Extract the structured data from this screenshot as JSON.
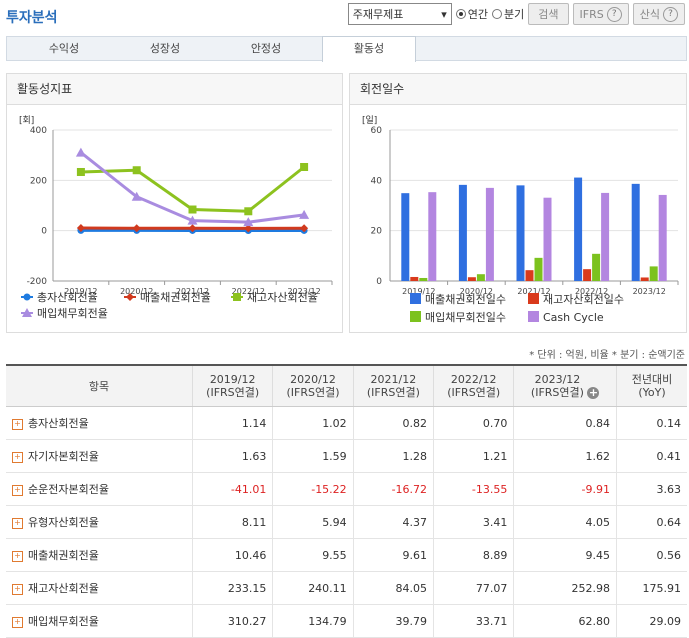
{
  "title": "투자분석",
  "controls": {
    "select_value": "주재무제표",
    "radio_annual": "연간",
    "radio_quarter": "분기",
    "search_label": "검색",
    "ifrs_label": "IFRS",
    "formula_label": "산식"
  },
  "tabs": [
    "수익성",
    "성장성",
    "안정성",
    "활동성"
  ],
  "active_tab": "활동성",
  "panel_left_title": "활동성지표",
  "panel_right_title": "회전일수",
  "unit_note": "* 단위 : 억원, 비율    * 분기 : 순액기준",
  "chart_data": [
    {
      "type": "line",
      "ylabel": "[회]",
      "ylim": [
        -200,
        400
      ],
      "yticks": [
        400,
        200,
        0,
        -200
      ],
      "categories": [
        "2019/12",
        "2020/12",
        "2021/12",
        "2022/12",
        "2023/12"
      ],
      "series": [
        {
          "name": "총자산회전율",
          "color": "#1e7be0",
          "marker": "circle",
          "values": [
            1.14,
            1.02,
            0.82,
            0.7,
            0.84
          ]
        },
        {
          "name": "매출채권회전율",
          "color": "#d13a1e",
          "marker": "diamond",
          "values": [
            10.46,
            9.55,
            9.61,
            8.89,
            9.45
          ]
        },
        {
          "name": "재고자산회전율",
          "color": "#8dc21f",
          "marker": "square",
          "values": [
            233.15,
            240.11,
            84.05,
            77.07,
            252.98
          ]
        },
        {
          "name": "매입채무회전율",
          "color": "#a98ce0",
          "marker": "triangle",
          "values": [
            310.27,
            134.79,
            39.79,
            33.71,
            62.8
          ]
        }
      ]
    },
    {
      "type": "bar",
      "ylabel": "[일]",
      "ylim": [
        0,
        60
      ],
      "yticks": [
        60,
        40,
        20,
        0
      ],
      "categories": [
        "2019/12",
        "2020/12",
        "2021/12",
        "2022/12",
        "2023/12"
      ],
      "series": [
        {
          "name": "매출채권회전일수",
          "color": "#2f6fe0",
          "values": [
            34.9,
            38.2,
            38.0,
            41.1,
            38.6
          ]
        },
        {
          "name": "재고자산회전일수",
          "color": "#d93a1c",
          "values": [
            1.6,
            1.5,
            4.3,
            4.7,
            1.4
          ]
        },
        {
          "name": "매입채무회전일수",
          "color": "#7cc21e",
          "values": [
            1.2,
            2.7,
            9.2,
            10.8,
            5.8
          ]
        },
        {
          "name": "Cash Cycle",
          "color": "#b386e0",
          "values": [
            35.3,
            37.0,
            33.1,
            35.0,
            34.2
          ]
        }
      ]
    }
  ],
  "table": {
    "headers": [
      "항목",
      "2019/12\n(IFRS연결)",
      "2020/12\n(IFRS연결)",
      "2021/12\n(IFRS연결)",
      "2022/12\n(IFRS연결)",
      "2023/12\n(IFRS연결)",
      "전년대비\n(YoY)"
    ],
    "rows": [
      {
        "label": "총자산회전율",
        "values": [
          "1.14",
          "1.02",
          "0.82",
          "0.70",
          "0.84",
          "0.14"
        ]
      },
      {
        "label": "자기자본회전율",
        "values": [
          "1.63",
          "1.59",
          "1.28",
          "1.21",
          "1.62",
          "0.41"
        ]
      },
      {
        "label": "순운전자본회전율",
        "values": [
          "-41.01",
          "-15.22",
          "-16.72",
          "-13.55",
          "-9.91",
          "3.63"
        ]
      },
      {
        "label": "유형자산회전율",
        "values": [
          "8.11",
          "5.94",
          "4.37",
          "3.41",
          "4.05",
          "0.64"
        ]
      },
      {
        "label": "매출채권회전율",
        "values": [
          "10.46",
          "9.55",
          "9.61",
          "8.89",
          "9.45",
          "0.56"
        ]
      },
      {
        "label": "재고자산회전율",
        "values": [
          "233.15",
          "240.11",
          "84.05",
          "77.07",
          "252.98",
          "175.91"
        ]
      },
      {
        "label": "매입채무회전율",
        "values": [
          "310.27",
          "134.79",
          "39.79",
          "33.71",
          "62.80",
          "29.09"
        ]
      }
    ]
  }
}
